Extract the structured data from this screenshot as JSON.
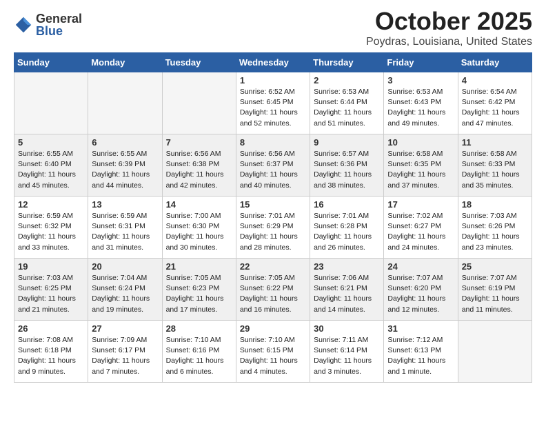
{
  "logo": {
    "general": "General",
    "blue": "Blue"
  },
  "title": "October 2025",
  "location": "Poydras, Louisiana, United States",
  "days_of_week": [
    "Sunday",
    "Monday",
    "Tuesday",
    "Wednesday",
    "Thursday",
    "Friday",
    "Saturday"
  ],
  "weeks": [
    {
      "shaded": false,
      "days": [
        {
          "num": "",
          "info": ""
        },
        {
          "num": "",
          "info": ""
        },
        {
          "num": "",
          "info": ""
        },
        {
          "num": "1",
          "info": "Sunrise: 6:52 AM\nSunset: 6:45 PM\nDaylight: 11 hours\nand 52 minutes."
        },
        {
          "num": "2",
          "info": "Sunrise: 6:53 AM\nSunset: 6:44 PM\nDaylight: 11 hours\nand 51 minutes."
        },
        {
          "num": "3",
          "info": "Sunrise: 6:53 AM\nSunset: 6:43 PM\nDaylight: 11 hours\nand 49 minutes."
        },
        {
          "num": "4",
          "info": "Sunrise: 6:54 AM\nSunset: 6:42 PM\nDaylight: 11 hours\nand 47 minutes."
        }
      ]
    },
    {
      "shaded": true,
      "days": [
        {
          "num": "5",
          "info": "Sunrise: 6:55 AM\nSunset: 6:40 PM\nDaylight: 11 hours\nand 45 minutes."
        },
        {
          "num": "6",
          "info": "Sunrise: 6:55 AM\nSunset: 6:39 PM\nDaylight: 11 hours\nand 44 minutes."
        },
        {
          "num": "7",
          "info": "Sunrise: 6:56 AM\nSunset: 6:38 PM\nDaylight: 11 hours\nand 42 minutes."
        },
        {
          "num": "8",
          "info": "Sunrise: 6:56 AM\nSunset: 6:37 PM\nDaylight: 11 hours\nand 40 minutes."
        },
        {
          "num": "9",
          "info": "Sunrise: 6:57 AM\nSunset: 6:36 PM\nDaylight: 11 hours\nand 38 minutes."
        },
        {
          "num": "10",
          "info": "Sunrise: 6:58 AM\nSunset: 6:35 PM\nDaylight: 11 hours\nand 37 minutes."
        },
        {
          "num": "11",
          "info": "Sunrise: 6:58 AM\nSunset: 6:33 PM\nDaylight: 11 hours\nand 35 minutes."
        }
      ]
    },
    {
      "shaded": false,
      "days": [
        {
          "num": "12",
          "info": "Sunrise: 6:59 AM\nSunset: 6:32 PM\nDaylight: 11 hours\nand 33 minutes."
        },
        {
          "num": "13",
          "info": "Sunrise: 6:59 AM\nSunset: 6:31 PM\nDaylight: 11 hours\nand 31 minutes."
        },
        {
          "num": "14",
          "info": "Sunrise: 7:00 AM\nSunset: 6:30 PM\nDaylight: 11 hours\nand 30 minutes."
        },
        {
          "num": "15",
          "info": "Sunrise: 7:01 AM\nSunset: 6:29 PM\nDaylight: 11 hours\nand 28 minutes."
        },
        {
          "num": "16",
          "info": "Sunrise: 7:01 AM\nSunset: 6:28 PM\nDaylight: 11 hours\nand 26 minutes."
        },
        {
          "num": "17",
          "info": "Sunrise: 7:02 AM\nSunset: 6:27 PM\nDaylight: 11 hours\nand 24 minutes."
        },
        {
          "num": "18",
          "info": "Sunrise: 7:03 AM\nSunset: 6:26 PM\nDaylight: 11 hours\nand 23 minutes."
        }
      ]
    },
    {
      "shaded": true,
      "days": [
        {
          "num": "19",
          "info": "Sunrise: 7:03 AM\nSunset: 6:25 PM\nDaylight: 11 hours\nand 21 minutes."
        },
        {
          "num": "20",
          "info": "Sunrise: 7:04 AM\nSunset: 6:24 PM\nDaylight: 11 hours\nand 19 minutes."
        },
        {
          "num": "21",
          "info": "Sunrise: 7:05 AM\nSunset: 6:23 PM\nDaylight: 11 hours\nand 17 minutes."
        },
        {
          "num": "22",
          "info": "Sunrise: 7:05 AM\nSunset: 6:22 PM\nDaylight: 11 hours\nand 16 minutes."
        },
        {
          "num": "23",
          "info": "Sunrise: 7:06 AM\nSunset: 6:21 PM\nDaylight: 11 hours\nand 14 minutes."
        },
        {
          "num": "24",
          "info": "Sunrise: 7:07 AM\nSunset: 6:20 PM\nDaylight: 11 hours\nand 12 minutes."
        },
        {
          "num": "25",
          "info": "Sunrise: 7:07 AM\nSunset: 6:19 PM\nDaylight: 11 hours\nand 11 minutes."
        }
      ]
    },
    {
      "shaded": false,
      "days": [
        {
          "num": "26",
          "info": "Sunrise: 7:08 AM\nSunset: 6:18 PM\nDaylight: 11 hours\nand 9 minutes."
        },
        {
          "num": "27",
          "info": "Sunrise: 7:09 AM\nSunset: 6:17 PM\nDaylight: 11 hours\nand 7 minutes."
        },
        {
          "num": "28",
          "info": "Sunrise: 7:10 AM\nSunset: 6:16 PM\nDaylight: 11 hours\nand 6 minutes."
        },
        {
          "num": "29",
          "info": "Sunrise: 7:10 AM\nSunset: 6:15 PM\nDaylight: 11 hours\nand 4 minutes."
        },
        {
          "num": "30",
          "info": "Sunrise: 7:11 AM\nSunset: 6:14 PM\nDaylight: 11 hours\nand 3 minutes."
        },
        {
          "num": "31",
          "info": "Sunrise: 7:12 AM\nSunset: 6:13 PM\nDaylight: 11 hours\nand 1 minute."
        },
        {
          "num": "",
          "info": ""
        }
      ]
    }
  ]
}
